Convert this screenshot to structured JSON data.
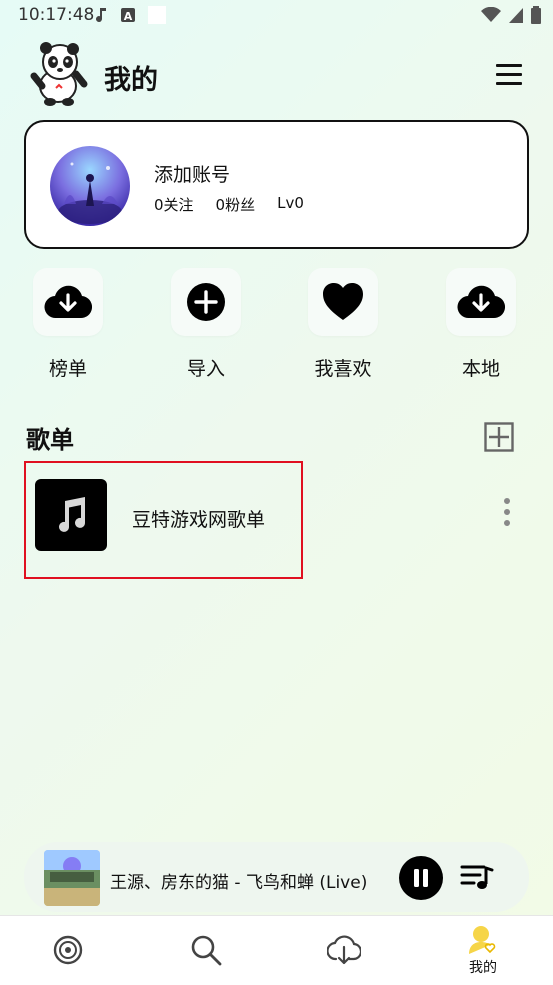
{
  "status_bar": {
    "time": "10:17:48"
  },
  "header": {
    "title": "我的"
  },
  "account": {
    "add_account": "添加账号",
    "following": "0关注",
    "fans": "0粉丝",
    "level": "Lv0"
  },
  "quick_actions": [
    {
      "label": "榜单",
      "icon": "cloud-download-icon"
    },
    {
      "label": "导入",
      "icon": "plus-circle-icon"
    },
    {
      "label": "我喜欢",
      "icon": "heart-icon"
    },
    {
      "label": "本地",
      "icon": "cloud-download-icon"
    }
  ],
  "playlists": {
    "section_title": "歌单",
    "items": [
      {
        "name": "豆特游戏网歌单",
        "icon": "music-note-icon"
      }
    ]
  },
  "player": {
    "track": "王源、房东的猫 - 飞鸟和蝉 (Live)",
    "state": "playing"
  },
  "bottom_nav": {
    "items": [
      {
        "label": "",
        "icon": "disc-icon"
      },
      {
        "label": "",
        "icon": "search-icon"
      },
      {
        "label": "",
        "icon": "cloud-download-icon"
      },
      {
        "label": "我的",
        "icon": "user-heart-icon"
      }
    ],
    "active_color": "#f6d548"
  },
  "colors": {
    "highlight_border": "#e01020",
    "accent_black": "#000000"
  }
}
